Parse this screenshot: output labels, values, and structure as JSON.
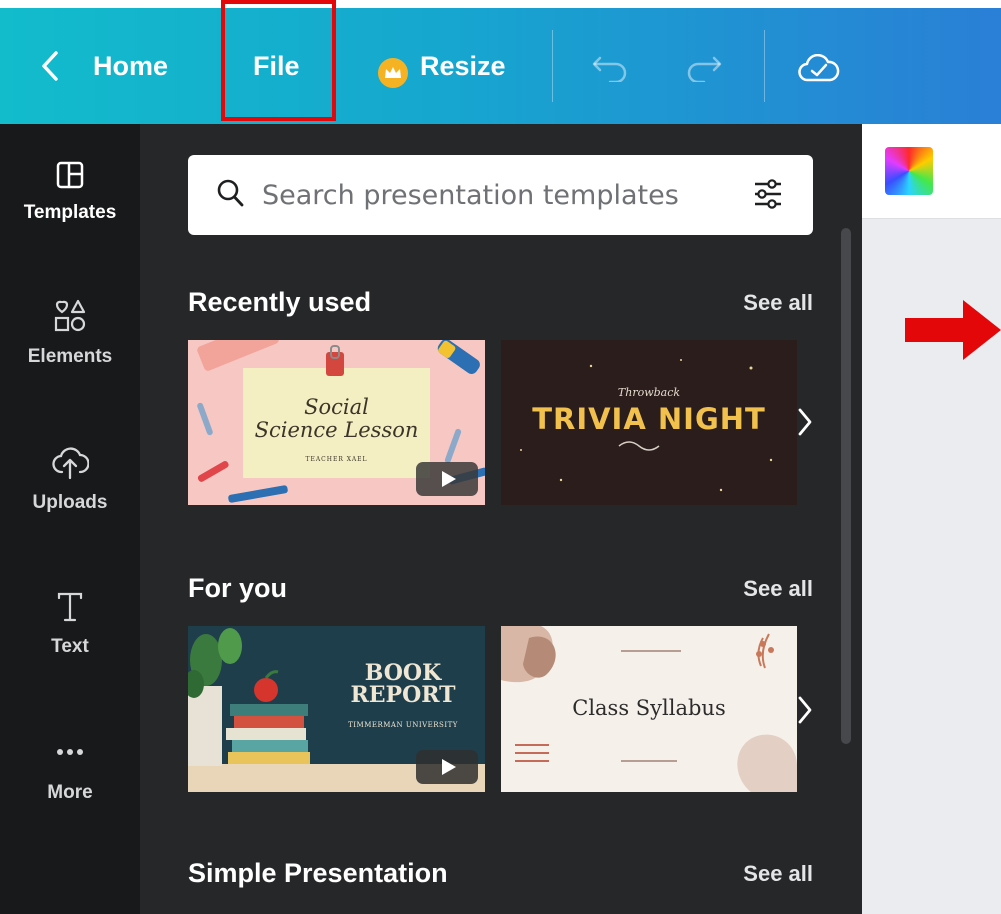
{
  "topbar": {
    "home_label": "Home",
    "file_label": "File",
    "resize_label": "Resize",
    "highlight_color": "#e4070a",
    "icons": [
      "chevron-left-icon",
      "crown-icon",
      "undo-icon",
      "redo-icon",
      "cloud-check-icon"
    ]
  },
  "rail": {
    "items": [
      {
        "label": "Templates",
        "icon": "templates-icon"
      },
      {
        "label": "Elements",
        "icon": "elements-icon"
      },
      {
        "label": "Uploads",
        "icon": "upload-cloud-icon"
      },
      {
        "label": "Text",
        "icon": "text-icon"
      },
      {
        "label": "More",
        "icon": "more-dots-icon"
      }
    ]
  },
  "search": {
    "placeholder": "Search presentation templates"
  },
  "sections": [
    {
      "title": "Recently used",
      "see_all": "See all",
      "thumbs": [
        {
          "line1": "Social",
          "line2": "Science Lesson",
          "caption": "TEACHER XAEL"
        },
        {
          "kicker": "Throwback",
          "title": "TRIVIA NIGHT"
        }
      ]
    },
    {
      "title": "For you",
      "see_all": "See all",
      "thumbs": [
        {
          "line1": "BOOK",
          "line2": "REPORT",
          "caption": "TIMMERMAN UNIVERSITY"
        },
        {
          "title": "Class Syllabus"
        }
      ]
    },
    {
      "title": "Simple Presentation",
      "see_all": "See all"
    }
  ],
  "colors": {
    "rail_bg": "#18191b",
    "panel_bg": "#262729",
    "canvas_bg": "#ebecf0",
    "arrow": "#e4070a"
  }
}
